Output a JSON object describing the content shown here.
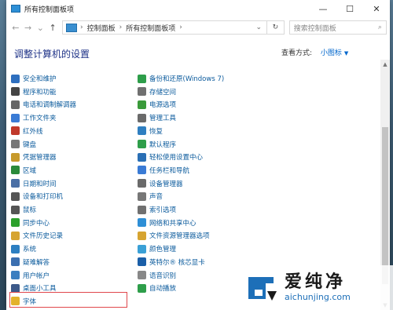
{
  "window": {
    "title": "所有控制面板项",
    "min_glyph": "—",
    "max_glyph": "☐",
    "close_glyph": "✕"
  },
  "nav": {
    "back": "←",
    "forward": "→",
    "recent": "⌄",
    "up": "↑"
  },
  "address": {
    "crumbs": [
      "控制面板",
      "所有控制面板项"
    ],
    "separator": "›",
    "dropdown": "⌄",
    "refresh": "↻"
  },
  "search": {
    "placeholder": "搜索控制面板",
    "icon": "⌕"
  },
  "header": {
    "title": "调整计算机的设置",
    "view_by_label": "查看方式:",
    "view_by_value": "小图标",
    "caret": "▼"
  },
  "items_left": [
    {
      "label": "安全和维护",
      "icon": "flag-icon",
      "color": "#2e6fbf"
    },
    {
      "label": "程序和功能",
      "icon": "programs-icon",
      "color": "#444444"
    },
    {
      "label": "电话和调制解调器",
      "icon": "phone-icon",
      "color": "#666666"
    },
    {
      "label": "工作文件夹",
      "icon": "folder-icon",
      "color": "#3a7bd5"
    },
    {
      "label": "红外线",
      "icon": "infrared-icon",
      "color": "#c0392b"
    },
    {
      "label": "键盘",
      "icon": "keyboard-icon",
      "color": "#777777"
    },
    {
      "label": "凭据管理器",
      "icon": "credential-icon",
      "color": "#c79a2b"
    },
    {
      "label": "区域",
      "icon": "region-icon",
      "color": "#2a8a3a"
    },
    {
      "label": "日期和时间",
      "icon": "clock-icon",
      "color": "#4a6fa5"
    },
    {
      "label": "设备和打印机",
      "icon": "printer-icon",
      "color": "#555555"
    },
    {
      "label": "鼠标",
      "icon": "mouse-icon",
      "color": "#555555"
    },
    {
      "label": "同步中心",
      "icon": "sync-icon",
      "color": "#2ca02c"
    },
    {
      "label": "文件历史记录",
      "icon": "history-icon",
      "color": "#d6a431"
    },
    {
      "label": "系统",
      "icon": "system-icon",
      "color": "#2d7fc1"
    },
    {
      "label": "疑难解答",
      "icon": "troubleshoot-icon",
      "color": "#3b6fb0"
    },
    {
      "label": "用户帐户",
      "icon": "users-icon",
      "color": "#3c7fc0"
    },
    {
      "label": "桌面小工具",
      "icon": "gadget-icon",
      "color": "#3c5a8a"
    },
    {
      "label": "字体",
      "icon": "font-icon",
      "color": "#e3b22b"
    }
  ],
  "items_right": [
    {
      "label": "备份和还原(Windows 7)",
      "icon": "backup-icon",
      "color": "#2e9e4a"
    },
    {
      "label": "存储空间",
      "icon": "storage-icon",
      "color": "#707070"
    },
    {
      "label": "电源选项",
      "icon": "power-icon",
      "color": "#3a9a3a"
    },
    {
      "label": "管理工具",
      "icon": "admin-tools-icon",
      "color": "#6a6a6a"
    },
    {
      "label": "恢复",
      "icon": "recovery-icon",
      "color": "#2f7fc1"
    },
    {
      "label": "默认程序",
      "icon": "default-programs-icon",
      "color": "#2e9e4a"
    },
    {
      "label": "轻松使用设置中心",
      "icon": "accessibility-icon",
      "color": "#2a6fb5"
    },
    {
      "label": "任务栏和导航",
      "icon": "taskbar-icon",
      "color": "#3a7bd5"
    },
    {
      "label": "设备管理器",
      "icon": "device-manager-icon",
      "color": "#6a6a6a"
    },
    {
      "label": "声音",
      "icon": "sound-icon",
      "color": "#777777"
    },
    {
      "label": "索引选项",
      "icon": "index-icon",
      "color": "#707070"
    },
    {
      "label": "网络和共享中心",
      "icon": "network-icon",
      "color": "#2e8fd6"
    },
    {
      "label": "文件资源管理器选项",
      "icon": "explorer-options-icon",
      "color": "#d6a431"
    },
    {
      "label": "颜色管理",
      "icon": "color-icon",
      "color": "#3aa0d6"
    },
    {
      "label": "英特尔® 核芯显卡",
      "icon": "intel-icon",
      "color": "#1b5fa8"
    },
    {
      "label": "语音识别",
      "icon": "mic-icon",
      "color": "#888888"
    },
    {
      "label": "自动播放",
      "icon": "autoplay-icon",
      "color": "#2e9e4a"
    }
  ],
  "watermark": {
    "brand": "爱纯净",
    "url": "aichunjing.com",
    "accent": "#1d6fb8"
  },
  "scroll": {
    "up": "▲",
    "down": "▼"
  }
}
